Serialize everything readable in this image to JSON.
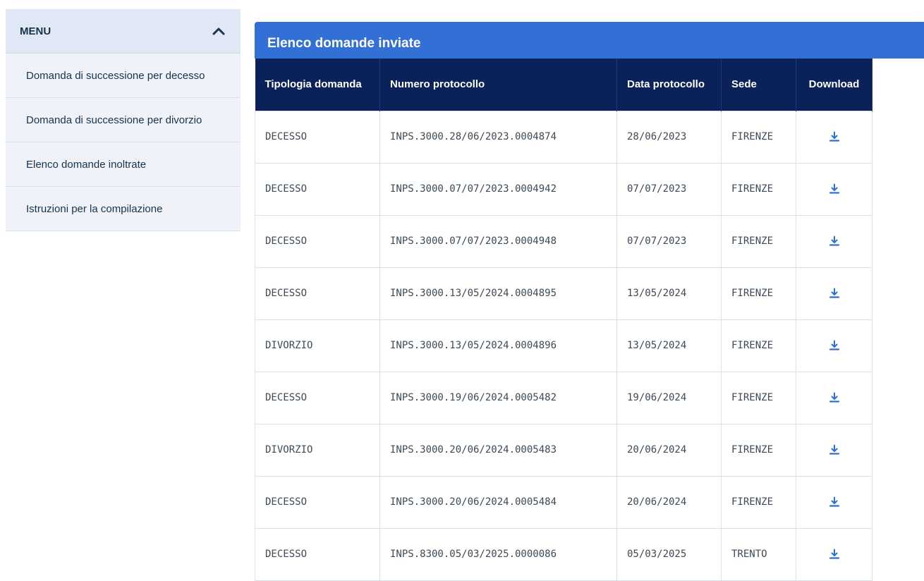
{
  "sidebar": {
    "title": "MENU",
    "items": [
      {
        "label": "Domanda di successione per decesso"
      },
      {
        "label": "Domanda di successione per divorzio"
      },
      {
        "label": "Elenco domande inoltrate"
      },
      {
        "label": "Istruzioni per la compilazione"
      }
    ]
  },
  "panel": {
    "title": "Elenco domande inviate"
  },
  "table": {
    "headers": [
      "Tipologia domanda",
      "Numero protocollo",
      "Data protocollo",
      "Sede",
      "Download"
    ],
    "rows": [
      [
        "DECESSO",
        "INPS.3000.28/06/2023.0004874",
        "28/06/2023",
        "FIRENZE"
      ],
      [
        "DECESSO",
        "INPS.3000.07/07/2023.0004942",
        "07/07/2023",
        "FIRENZE"
      ],
      [
        "DECESSO",
        "INPS.3000.07/07/2023.0004948",
        "07/07/2023",
        "FIRENZE"
      ],
      [
        "DECESSO",
        "INPS.3000.13/05/2024.0004895",
        "13/05/2024",
        "FIRENZE"
      ],
      [
        "DIVORZIO",
        "INPS.3000.13/05/2024.0004896",
        "13/05/2024",
        "FIRENZE"
      ],
      [
        "DECESSO",
        "INPS.3000.19/06/2024.0005482",
        "19/06/2024",
        "FIRENZE"
      ],
      [
        "DIVORZIO",
        "INPS.3000.20/06/2024.0005483",
        "20/06/2024",
        "FIRENZE"
      ],
      [
        "DECESSO",
        "INPS.3000.20/06/2024.0005484",
        "20/06/2024",
        "FIRENZE"
      ],
      [
        "DECESSO",
        "INPS.8300.05/03/2025.0000086",
        "05/03/2025",
        "TRENTO"
      ]
    ]
  },
  "icons": {
    "menu_toggle": "chevron-up-icon",
    "download": "download-icon"
  },
  "colors": {
    "accent": "#3270d6",
    "table_header": "#0a2259",
    "sidebar_bg": "#eff3f9"
  }
}
